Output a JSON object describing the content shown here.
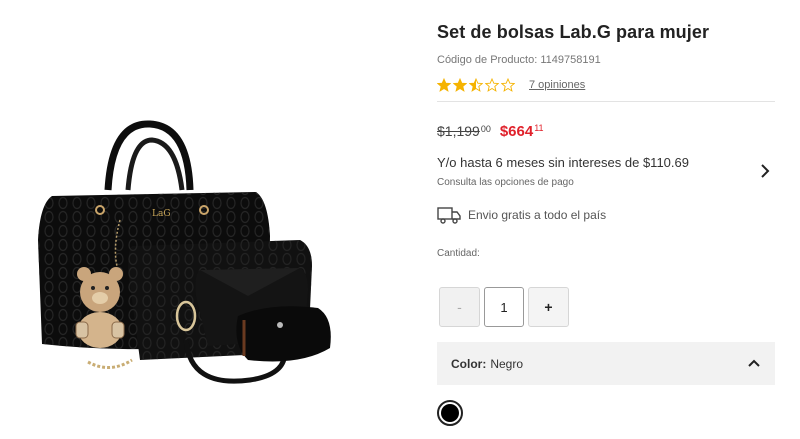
{
  "product": {
    "title": "Set de bolsas Lab.G para mujer",
    "sku_label": "Código de Producto:",
    "sku": "1149758191",
    "rating": 2.5,
    "rating_max": 5,
    "reviews_link": "7 opiniones",
    "image_icon": "handbag-set-image",
    "bag_logo": "LaG"
  },
  "price": {
    "old_whole": "$1,199",
    "old_cents": "00",
    "new_whole": "$664",
    "new_cents": "11",
    "old_color": "#444444",
    "new_color": "#e0212b"
  },
  "installments": {
    "text": "Y/o hasta 6 meses sin intereses de $110.69",
    "subtext": "Consulta las opciones de pago"
  },
  "shipping": {
    "text": "Envio gratis a todo el país"
  },
  "quantity": {
    "label": "Cantidad:",
    "minus": "-",
    "value": "1",
    "plus": "+"
  },
  "color": {
    "label": "Color:",
    "value": "Negro",
    "swatch": "#000000"
  },
  "theme": {
    "star_color": "#f5b301",
    "accordion_bg": "#f2f2f2"
  }
}
